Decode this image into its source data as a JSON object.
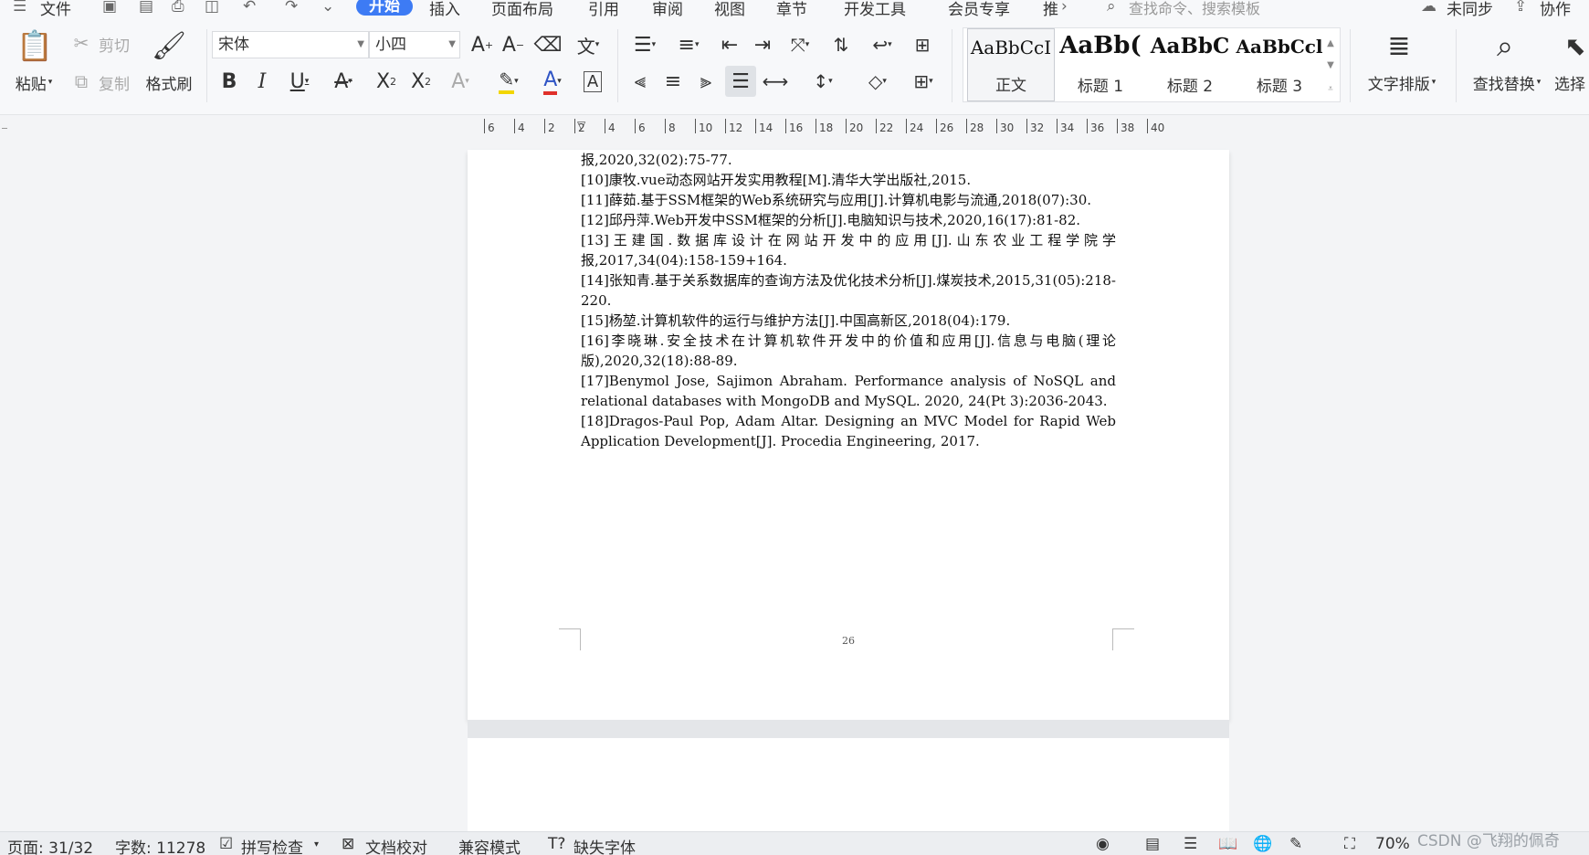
{
  "menubar": {
    "file": "文件",
    "tabs": [
      "开始",
      "插入",
      "页面布局",
      "引用",
      "审阅",
      "视图",
      "章节",
      "开发工具",
      "会员专享",
      "推"
    ],
    "search_placeholder": "查找命令、搜索模板",
    "sync_label": "未同步",
    "collab_label": "协作"
  },
  "ribbon": {
    "paste": "粘贴",
    "cut": "剪切",
    "copy": "复制",
    "format_painter": "格式刷",
    "font_name": "宋体",
    "font_size": "小四",
    "styles": [
      {
        "preview": "AaBbCcI",
        "name": "正文"
      },
      {
        "preview": "AaBb(",
        "name": "标题 1"
      },
      {
        "preview": "AaBbC",
        "name": "标题 2"
      },
      {
        "preview": "AaBbCcl",
        "name": "标题 3"
      }
    ],
    "text_layout": "文字排版",
    "find_replace": "查找替换",
    "select": "选择"
  },
  "ruler": {
    "ticks": [
      "6",
      "4",
      "2",
      "2",
      "4",
      "6",
      "8",
      "10",
      "12",
      "14",
      "16",
      "18",
      "20",
      "22",
      "24",
      "26",
      "28",
      "30",
      "32",
      "34",
      "36",
      "38",
      "40"
    ]
  },
  "document": {
    "references": [
      "报,2020,32(02):75-77.",
      "[10]康牧.vue动态网站开发实用教程[M].清华大学出版社,2015.",
      "[11]薛茹.基于SSM框架的Web系统研究与应用[J].计算机电影与流通,2018(07):30.",
      "[12]邱丹萍.Web开发中SSM框架的分析[J].电脑知识与技术,2020,16(17):81-82.",
      "[13]王建国.数据库设计在网站开发中的应用[J].山东农业工程学院学报,2017,34(04):158-159+164.",
      "[14]张知青.基于关系数据库的查询方法及优化技术分析[J].煤炭技术,2015,31(05):218-220.",
      "[15]杨堃.计算机软件的运行与维护方法[J].中国高新区,2018(04):179.",
      "[16]李晓琳.安全技术在计算机软件开发中的价值和应用[J].信息与电脑(理论版),2020,32(18):88-89.",
      "[17]Benymol Jose, Sajimon Abraham. Performance analysis of NoSQL and relational databases with MongoDB and MySQL. 2020, 24(Pt 3):2036-2043.",
      "[18]Dragos-Paul Pop, Adam Altar. Designing an MVC Model for Rapid Web Application Development[J]. Procedia Engineering, 2017."
    ],
    "page_number": "26"
  },
  "status": {
    "page": "页面: 31/32",
    "words": "字数: 11278",
    "spell_check": "拼写检查",
    "doc_proof": "文档校对",
    "compat_mode": "兼容模式",
    "missing_fonts": "缺失字体",
    "zoom": "70%"
  },
  "watermark": "CSDN @飞翔的佩奇"
}
